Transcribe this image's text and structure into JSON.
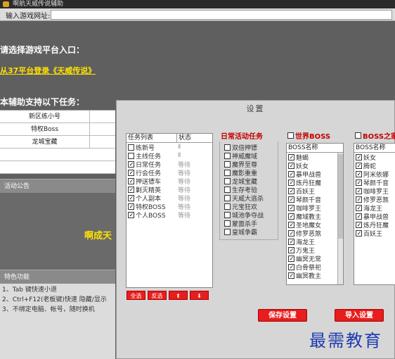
{
  "window": {
    "title": "啊航天威传说辅助"
  },
  "urlbar": {
    "label": "输入游戏网址:",
    "value": ""
  },
  "main": {
    "choose_platform": "请选择游戏平台入口：",
    "login_link": "从37平台登录《天威传说》",
    "support_tasks": "本辅助支持以下任务：",
    "task_table": [
      "新区练小号",
      "特权Boss",
      "龙城宝藏",
      "",
      ""
    ],
    "notice_header": "活动公告",
    "welcome_text": "啊成天",
    "features_header": "特色功能",
    "features": [
      "1、Tab 键快速小退",
      "2、Ctrl+F12(老板键)快速 隐藏/显示",
      "3、不绑定电脑、帐号，随时换机"
    ]
  },
  "dialog": {
    "title": "设置",
    "task_list": {
      "col_task": "任务列表",
      "col_status": "状态",
      "items": [
        {
          "name": "练新号",
          "checked": false,
          "status": "Ⅱ"
        },
        {
          "name": "主线任务",
          "checked": false,
          "status": "Ⅱ"
        },
        {
          "name": "日常任务",
          "checked": true,
          "status": "等待"
        },
        {
          "name": "行会任务",
          "checked": true,
          "status": "等待"
        },
        {
          "name": "押送镖车",
          "checked": true,
          "status": "等待"
        },
        {
          "name": "剿灭精英",
          "checked": true,
          "status": "等待"
        },
        {
          "name": "个人副本",
          "checked": true,
          "status": "等待"
        },
        {
          "name": "特权BOSS",
          "checked": true,
          "status": "等待"
        },
        {
          "name": "个人BOSS",
          "checked": true,
          "status": "等待"
        }
      ],
      "buttons": [
        "全选",
        "反选",
        "⬆",
        "⬇"
      ]
    },
    "daily": {
      "title": "日常活动任务",
      "items": [
        "双倍押镖",
        "神威魔域",
        "魔界至尊",
        "魔影重重",
        "龙城宝藏",
        "生存考验",
        "天威大逃杀",
        "元宝狂欢",
        "城池争夺战",
        "蒙面杀手",
        "皇城争霸"
      ]
    },
    "world_boss": {
      "title": "世界BOSS",
      "col": "BOSS名称",
      "items": [
        "魅蝎",
        "妖女",
        "暴甲战兽",
        "炼丹狂魔",
        "百妖王",
        "琴颜千音",
        "咖啡罗王",
        "魔域教主",
        "圣地魔女",
        "修罗恶煞",
        "海龙王",
        "万鬼王",
        "幽冥无常",
        "白骨祭祀",
        "幽冥教主"
      ]
    },
    "boss_home": {
      "title": "BOSS之家",
      "col": "BOSS名称",
      "items": [
        "妖女",
        "腾蛇",
        "阿米依娜",
        "琴颜千音",
        "咖啡罗王",
        "修罗恶煞",
        "海龙王",
        "暴甲战兽",
        "炼丹狂魔",
        "百妖王"
      ]
    },
    "save_button": "保存设置",
    "import_button": "导入设置"
  },
  "watermark": "最需教育"
}
